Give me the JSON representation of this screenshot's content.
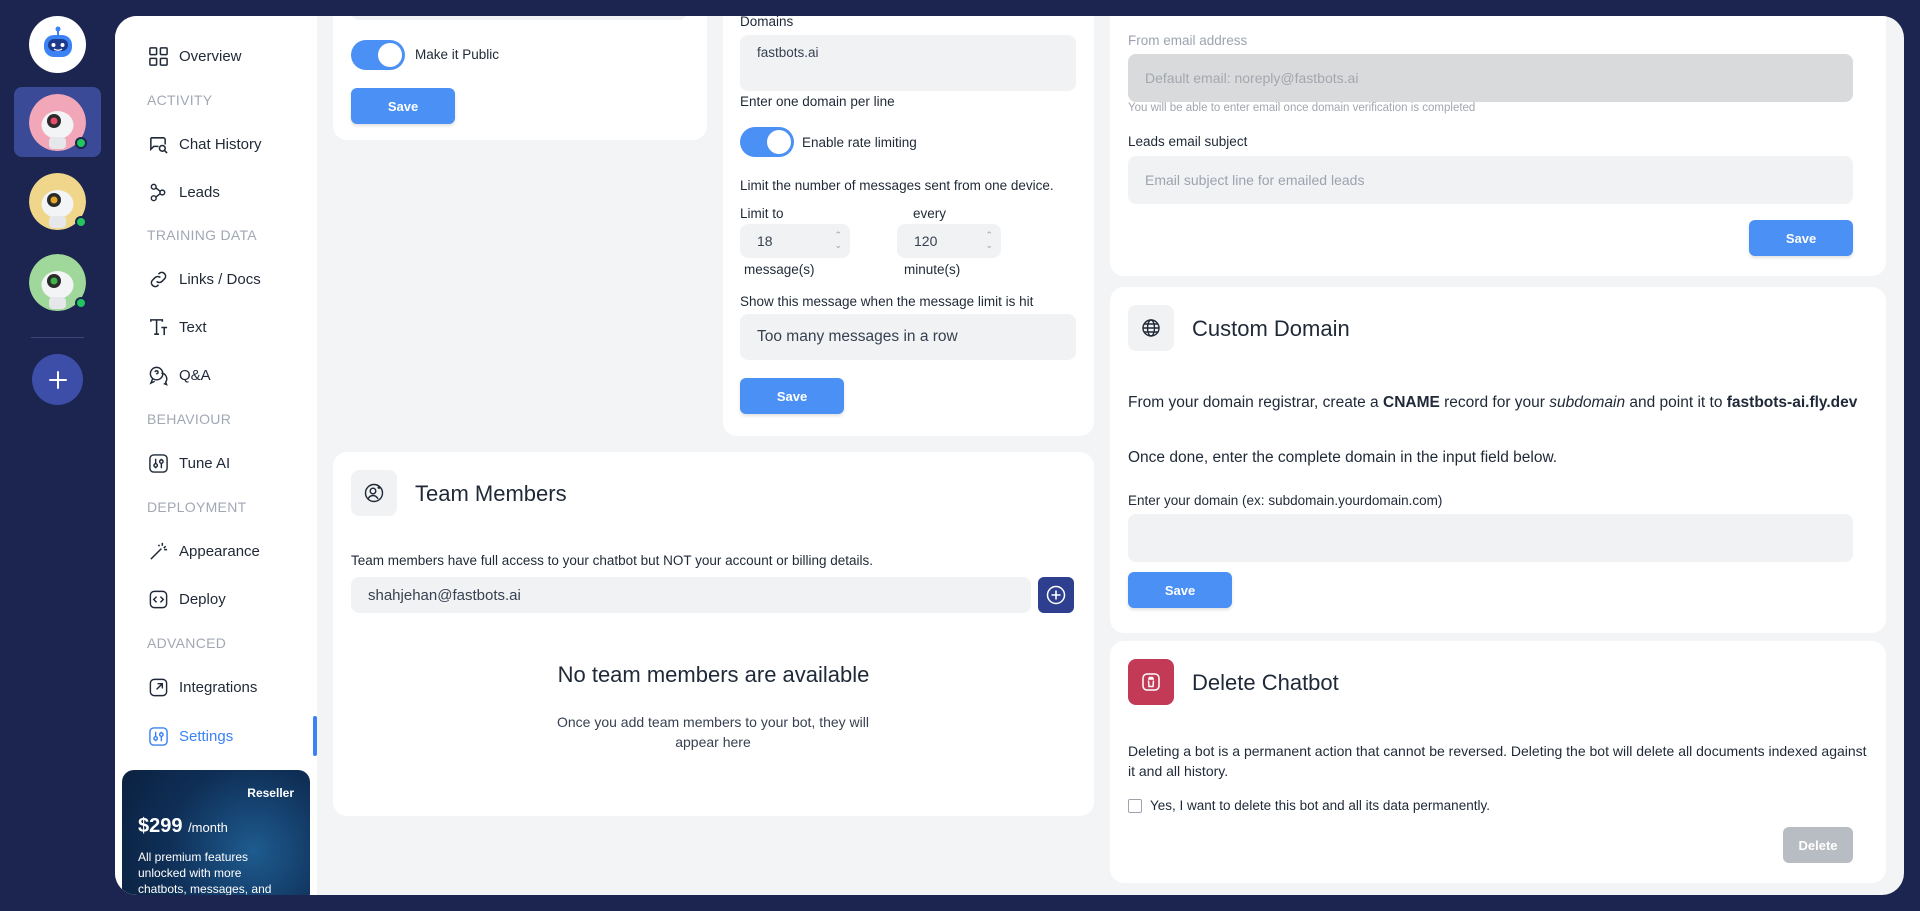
{
  "sidebar": {
    "items": [
      {
        "label": "Overview"
      },
      {
        "label": "Chat History"
      },
      {
        "label": "Leads"
      },
      {
        "label": "Links / Docs"
      },
      {
        "label": "Text"
      },
      {
        "label": "Q&A"
      },
      {
        "label": "Tune AI"
      },
      {
        "label": "Appearance"
      },
      {
        "label": "Deploy"
      },
      {
        "label": "Integrations"
      },
      {
        "label": "Settings"
      }
    ],
    "sections": [
      "ACTIVITY",
      "TRAINING DATA",
      "BEHAVIOUR",
      "DEPLOYMENT",
      "ADVANCED"
    ],
    "active_color": "#3b82f6"
  },
  "reseller": {
    "tag": "Reseller",
    "price": "$299",
    "period": "/month",
    "desc": "All premium features unlocked with more chatbots, messages, and"
  },
  "public_card": {
    "toggle_label": "Make it Public",
    "save_label": "Save"
  },
  "security_card": {
    "domains_label": "Domains",
    "domains_value": "fastbots.ai",
    "domains_hint": "Enter one domain per line",
    "rate_toggle_label": "Enable rate limiting",
    "rate_desc": "Limit the number of messages sent from one device.",
    "limit_to_label": "Limit to",
    "every_label": "every",
    "limit_value": "18",
    "every_value": "120",
    "messages_unit": "message(s)",
    "minutes_unit": "minute(s)",
    "limit_message_label": "Show this message when the message limit is hit",
    "limit_message_value": "Too many messages in a row",
    "save_label": "Save"
  },
  "email_card": {
    "from_label": "From email address",
    "from_placeholder": "Default email: noreply@fastbots.ai",
    "from_hint": "You will be able to enter email once domain verification is completed",
    "subject_label": "Leads email subject",
    "subject_placeholder": "Email subject line for emailed leads",
    "save_label": "Save"
  },
  "custom_domain": {
    "title": "Custom Domain",
    "line1_a": "From your domain registrar, create a ",
    "line1_b": "CNAME",
    "line1_c": " record for your ",
    "line1_d": "subdomain",
    "line1_e": " and point it to ",
    "line1_f": "fastbots-ai.fly.dev",
    "line2": "Once done, enter the complete domain in the input field below.",
    "input_label": "Enter your domain (ex: subdomain.yourdomain.com)",
    "save_label": "Save"
  },
  "team": {
    "title": "Team Members",
    "desc": "Team members have full access to your chatbot but NOT your account or billing details.",
    "email_value": "shahjehan@fastbots.ai",
    "empty_title": "No team members are available",
    "empty_desc": "Once you add team members to your bot, they will appear here"
  },
  "delete": {
    "title": "Delete Chatbot",
    "desc": "Deleting a bot is a permanent action that cannot be reversed. Deleting the bot will delete all documents indexed against it and all history.",
    "checkbox_label": "Yes, I want to delete this bot and all its data permanently.",
    "button_label": "Delete"
  }
}
